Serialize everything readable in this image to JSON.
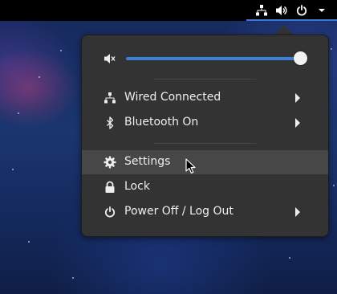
{
  "top_bar": {
    "tray_icons": [
      "network-wired-icon",
      "speaker-volume-icon",
      "power-icon"
    ]
  },
  "volume": {
    "icon": "speaker-muted-icon",
    "level_percent": 100
  },
  "menu": {
    "network": {
      "label": "Wired Connected",
      "icon": "network-wired-icon"
    },
    "bluetooth": {
      "label": "Bluetooth On",
      "icon": "bluetooth-icon"
    },
    "settings": {
      "label": "Settings",
      "icon": "gear-icon"
    },
    "lock": {
      "label": "Lock",
      "icon": "lock-icon"
    },
    "power": {
      "label": "Power Off / Log Out",
      "icon": "power-icon"
    }
  },
  "colors": {
    "accent": "#3e7fd8",
    "menu_bg": "#333333",
    "hover_bg": "#474747",
    "text": "#eeeeec",
    "top_bar": "#000000"
  }
}
